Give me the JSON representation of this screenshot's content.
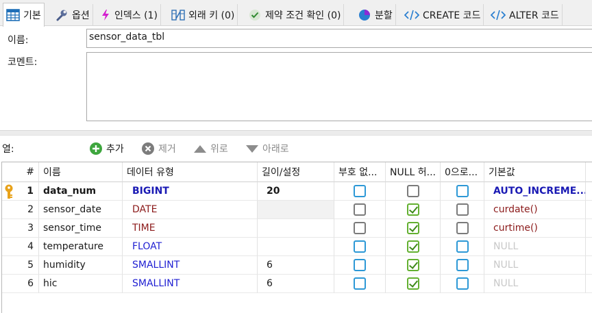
{
  "tabs": [
    {
      "label": "기본",
      "icon": "table-icon",
      "active": true
    },
    {
      "label": "옵션",
      "icon": "wrench-icon"
    },
    {
      "label": "인덱스 (1)",
      "icon": "lightning-icon"
    },
    {
      "label": "외래 키 (0)",
      "icon": "foreign-key-icon"
    },
    {
      "label": "제약 조건 확인 (0)",
      "icon": "check-circle-icon"
    },
    {
      "label": "분할",
      "icon": "pie-icon"
    },
    {
      "label": "CREATE 코드",
      "icon": "code-icon"
    },
    {
      "label": "ALTER 코드",
      "icon": "code-icon"
    }
  ],
  "form": {
    "name_label": "이름:",
    "name_value": "sensor_data_tbl",
    "comment_label": "코멘트:",
    "comment_value": ""
  },
  "toolbar": {
    "columns_label": "열:",
    "add_label": "추가",
    "remove_label": "제거",
    "up_label": "위로",
    "down_label": "아래로"
  },
  "grid": {
    "headers": [
      "#",
      "이름",
      "데이터 유형",
      "길이/설정",
      "부호 없...",
      "NULL 허...",
      "0으로...",
      "기본값"
    ],
    "rows": [
      {
        "num": "1",
        "name": "data_num",
        "type": "BIGINT",
        "length": "20",
        "unsigned": false,
        "nullable": false,
        "zerofill": false,
        "default": "AUTO_INCREME...",
        "primary_key": true
      },
      {
        "num": "2",
        "name": "sensor_date",
        "type": "DATE",
        "length": "",
        "unsigned": false,
        "nullable": true,
        "zerofill": false,
        "default": "curdate()"
      },
      {
        "num": "3",
        "name": "sensor_time",
        "type": "TIME",
        "length": "",
        "unsigned": false,
        "nullable": true,
        "zerofill": false,
        "default": "curtime()"
      },
      {
        "num": "4",
        "name": "temperature",
        "type": "FLOAT",
        "length": "",
        "unsigned": false,
        "nullable": true,
        "zerofill": false,
        "default": "NULL"
      },
      {
        "num": "5",
        "name": "humidity",
        "type": "SMALLINT",
        "length": "6",
        "unsigned": false,
        "nullable": true,
        "zerofill": false,
        "default": "NULL"
      },
      {
        "num": "6",
        "name": "hic",
        "type": "SMALLINT",
        "length": "6",
        "unsigned": false,
        "nullable": true,
        "zerofill": false,
        "default": "NULL"
      }
    ]
  },
  "colors": {
    "accent_blue": "#2c98d6",
    "check_green": "#63b030",
    "type_int": "#1e1ed2",
    "type_date": "#8b1a1a",
    "key_gold": "#e8a21a"
  }
}
